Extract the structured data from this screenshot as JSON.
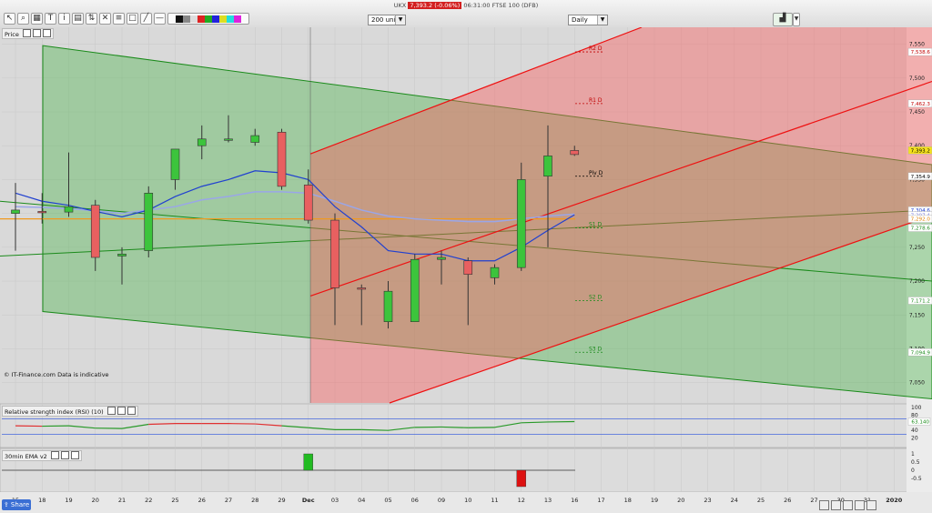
{
  "ticker": {
    "symbol": "UKX",
    "price": "7,393.2 (-0.06%)",
    "time": "06:31:00 FTSE 100 (DFB)"
  },
  "toolbar": {
    "units": "200 units",
    "interval": "Daily"
  },
  "panels": {
    "price_label": "Price",
    "rsi_label": "Relative strength index (RSI) (10)",
    "ema_label": "30min EMA v2",
    "copyright": "© IT-Finance.com  Data is indicative"
  },
  "price_axis": {
    "ticks": [
      "7,550",
      "7,500",
      "7,450",
      "7,400",
      "7,350",
      "7,300",
      "7,250",
      "7,200",
      "7,150",
      "7,100",
      "7,050"
    ],
    "tags": [
      {
        "label": "7,538.6",
        "value": 7538.6,
        "color": "#ffffff",
        "text": "#c00000"
      },
      {
        "label": "7,462.3",
        "value": 7462.3,
        "color": "#ffffff",
        "text": "#c00000"
      },
      {
        "label": "7,393.2",
        "value": 7393.2,
        "color": "#f5e21c",
        "text": "#000000"
      },
      {
        "label": "7,354.9",
        "value": 7354.9,
        "color": "#ffffff",
        "text": "#000000"
      },
      {
        "label": "7,304.6",
        "value": 7304.6,
        "color": "#ffffff",
        "text": "#2040d0"
      },
      {
        "label": "7,297.4",
        "value": 7297.4,
        "color": "#ffffff",
        "text": "#8080e0"
      },
      {
        "label": "7,292.0",
        "value": 7292.0,
        "color": "#ffffff",
        "text": "#e08000"
      },
      {
        "label": "7,278.6",
        "value": 7278.6,
        "color": "#ffffff",
        "text": "#1a8a1a"
      },
      {
        "label": "7,171.2",
        "value": 7171.2,
        "color": "#ffffff",
        "text": "#1a8a1a"
      },
      {
        "label": "7,094.9",
        "value": 7094.9,
        "color": "#ffffff",
        "text": "#1a8a1a"
      }
    ]
  },
  "rsi_axis": {
    "ticks": [
      "100",
      "80",
      "60",
      "40",
      "20"
    ],
    "current": "63.140"
  },
  "ema_axis": {
    "ticks": [
      "1",
      "0.5",
      "0",
      "-0.5"
    ]
  },
  "x_axis": {
    "labels": [
      "15",
      "18",
      "19",
      "20",
      "21",
      "22",
      "25",
      "26",
      "27",
      "28",
      "29",
      "Dec",
      "03",
      "04",
      "05",
      "06",
      "09",
      "10",
      "11",
      "12",
      "13",
      "16",
      "17",
      "18",
      "19",
      "20",
      "23",
      "24",
      "25",
      "26",
      "27",
      "30",
      "31",
      "2020"
    ]
  },
  "chart_data": {
    "type": "candlestick",
    "y_range": [
      7020,
      7575
    ],
    "x": [
      "15",
      "18",
      "19",
      "20",
      "21",
      "22",
      "25",
      "26",
      "27",
      "28",
      "29",
      "Dec",
      "03",
      "04",
      "05",
      "06",
      "09",
      "10",
      "11",
      "12",
      "13",
      "16"
    ],
    "candles": [
      {
        "d": "15",
        "o": 7300,
        "h": 7345,
        "l": 7245,
        "c": 7305
      },
      {
        "d": "18",
        "o": 7303,
        "h": 7330,
        "l": 7285,
        "c": 7302
      },
      {
        "d": "19",
        "o": 7302,
        "h": 7390,
        "l": 7295,
        "c": 7310
      },
      {
        "d": "20",
        "o": 7312,
        "h": 7320,
        "l": 7215,
        "c": 7235
      },
      {
        "d": "21",
        "o": 7237,
        "h": 7250,
        "l": 7195,
        "c": 7240
      },
      {
        "d": "22",
        "o": 7245,
        "h": 7340,
        "l": 7235,
        "c": 7330
      },
      {
        "d": "25",
        "o": 7350,
        "h": 7395,
        "l": 7335,
        "c": 7395
      },
      {
        "d": "26",
        "o": 7400,
        "h": 7430,
        "l": 7380,
        "c": 7410
      },
      {
        "d": "27",
        "o": 7410,
        "h": 7445,
        "l": 7405,
        "c": 7410
      },
      {
        "d": "28",
        "o": 7405,
        "h": 7425,
        "l": 7400,
        "c": 7415
      },
      {
        "d": "29",
        "o": 7420,
        "h": 7425,
        "l": 7335,
        "c": 7340
      },
      {
        "d": "Dec",
        "o": 7342,
        "h": 7365,
        "l": 7285,
        "c": 7290
      },
      {
        "d": "03",
        "o": 7290,
        "h": 7300,
        "l": 7135,
        "c": 7190
      },
      {
        "d": "04",
        "o": 7190,
        "h": 7195,
        "l": 7135,
        "c": 7188
      },
      {
        "d": "05",
        "o": 7140,
        "h": 7200,
        "l": 7130,
        "c": 7185
      },
      {
        "d": "06",
        "o": 7140,
        "h": 7240,
        "l": 7140,
        "c": 7232
      },
      {
        "d": "09",
        "o": 7232,
        "h": 7245,
        "l": 7195,
        "c": 7235
      },
      {
        "d": "10",
        "o": 7230,
        "h": 7235,
        "l": 7135,
        "c": 7210
      },
      {
        "d": "11",
        "o": 7205,
        "h": 7225,
        "l": 7195,
        "c": 7220
      },
      {
        "d": "12",
        "o": 7220,
        "h": 7375,
        "l": 7215,
        "c": 7350
      },
      {
        "d": "13",
        "o": 7355,
        "h": 7430,
        "l": 7250,
        "c": 7385
      },
      {
        "d": "16",
        "o": 7393,
        "h": 7400,
        "l": 7385,
        "c": 7387
      }
    ],
    "ema_fast": [
      7330,
      7318,
      7312,
      7303,
      7295,
      7305,
      7325,
      7340,
      7350,
      7363,
      7360,
      7350,
      7310,
      7280,
      7245,
      7240,
      7240,
      7230,
      7230,
      7250,
      7275,
      7298
    ],
    "ema_slow": [
      7310,
      7309,
      7307,
      7304,
      7300,
      7305,
      7310,
      7320,
      7325,
      7332,
      7332,
      7330,
      7318,
      7305,
      7296,
      7292,
      7290,
      7288,
      7288,
      7292,
      7296,
      7299
    ],
    "ma_orange": [
      7292,
      7292,
      7292,
      7292,
      7292,
      7292,
      7292,
      7292,
      7292,
      7292,
      7292,
      7292,
      7292,
      7292,
      7292,
      7292,
      7292,
      7292,
      7292,
      7292,
      7292,
      7292
    ],
    "pivots": [
      {
        "label": "R2 D",
        "value": 7538.6,
        "color": "#c00000"
      },
      {
        "label": "R1 D",
        "value": 7462.3,
        "color": "#c00000"
      },
      {
        "label": "Piv D",
        "value": 7354.9,
        "color": "#000000"
      },
      {
        "label": "S1 D",
        "value": 7278.6,
        "color": "#1a8a1a"
      },
      {
        "label": "S2 D",
        "value": 7171.2,
        "color": "#1a8a1a"
      },
      {
        "label": "S3 D",
        "value": 7094.9,
        "color": "#1a8a1a"
      }
    ],
    "rsi": [
      52,
      51,
      52,
      46,
      45,
      56,
      58,
      58,
      58,
      57,
      52,
      47,
      42,
      42,
      40,
      48,
      49,
      47,
      48,
      60,
      62,
      63.14
    ],
    "rsi_range": [
      0,
      100
    ],
    "ema_signal": [
      {
        "d": "Dec",
        "value": 1,
        "color": "#22bb22"
      },
      {
        "d": "12",
        "value": -1,
        "color": "#dd1111"
      }
    ]
  },
  "colors": {
    "bull": "#3cc43c",
    "bear": "#e86060",
    "green_channel": "#1a8a1a",
    "red_channel": "#ee1111"
  }
}
